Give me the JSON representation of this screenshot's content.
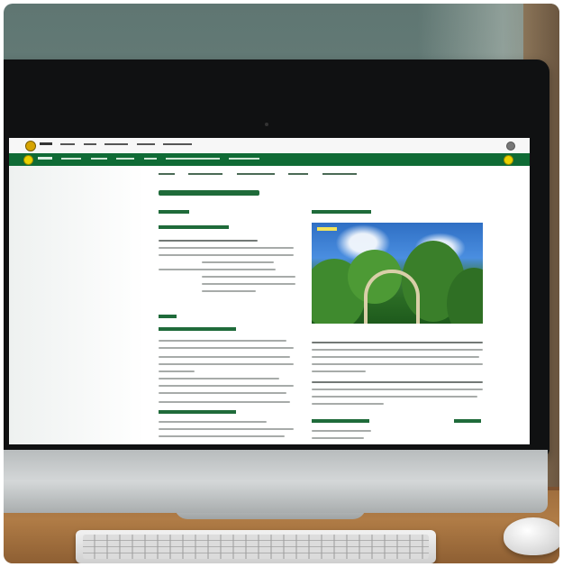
{
  "colors": {
    "wall": "#6e8580",
    "desk": "#b07c46",
    "bezel": "#101112",
    "site_green": "#0f6b35",
    "heading_green": "#1f6b3a"
  },
  "screen": {
    "browser_bar": {
      "logo_icon": "site-logo-icon",
      "search_icon": "search-icon"
    },
    "nav": {
      "logo_icon": "nav-logo-icon",
      "right_icon": "nav-badge-icon"
    },
    "page_title": "",
    "hero_image": {
      "description_icon": "forest-arch-image"
    }
  },
  "objects": {
    "keyboard": "keyboard",
    "mouse": "mouse",
    "monitor": "desktop-monitor"
  }
}
